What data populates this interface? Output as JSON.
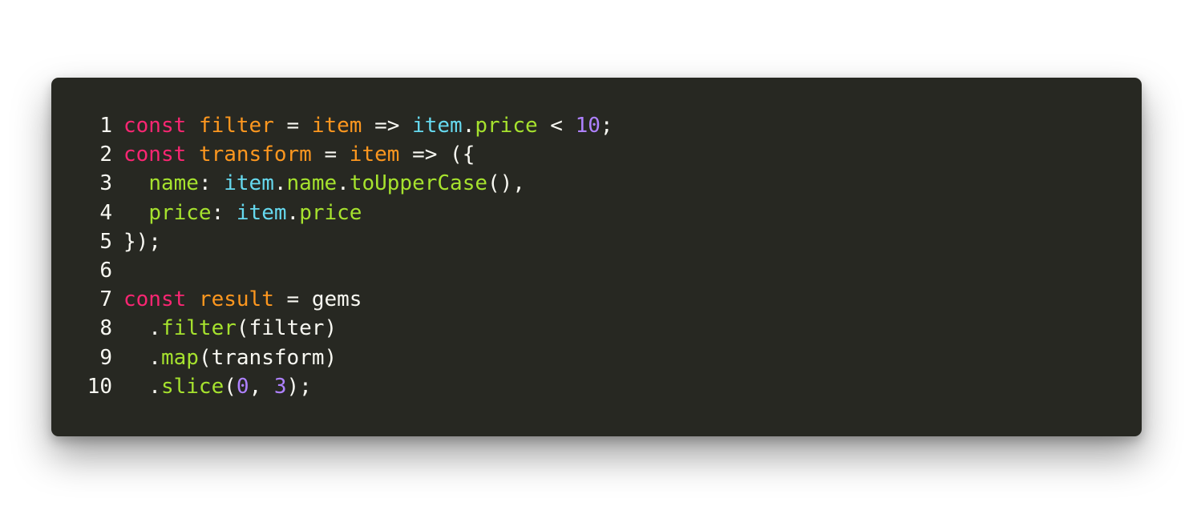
{
  "theme": {
    "background": "#272822",
    "text": "#f8f8f2",
    "keyword": "#f92672",
    "definition": "#fd971f",
    "property": "#a6e22e",
    "variable": "#66d9ef",
    "number": "#ae81ff"
  },
  "code": {
    "lines": [
      {
        "number": "1",
        "tokens": [
          {
            "text": "const",
            "type": "keyword"
          },
          {
            "text": " ",
            "type": "plain"
          },
          {
            "text": "filter",
            "type": "def"
          },
          {
            "text": " = ",
            "type": "plain"
          },
          {
            "text": "item",
            "type": "def"
          },
          {
            "text": " => ",
            "type": "plain"
          },
          {
            "text": "item",
            "type": "variable"
          },
          {
            "text": ".",
            "type": "plain"
          },
          {
            "text": "price",
            "type": "property"
          },
          {
            "text": " < ",
            "type": "plain"
          },
          {
            "text": "10",
            "type": "number"
          },
          {
            "text": ";",
            "type": "plain"
          }
        ]
      },
      {
        "number": "2",
        "tokens": [
          {
            "text": "const",
            "type": "keyword"
          },
          {
            "text": " ",
            "type": "plain"
          },
          {
            "text": "transform",
            "type": "def"
          },
          {
            "text": " = ",
            "type": "plain"
          },
          {
            "text": "item",
            "type": "def"
          },
          {
            "text": " => ({",
            "type": "plain"
          }
        ]
      },
      {
        "number": "3",
        "tokens": [
          {
            "text": "  ",
            "type": "plain"
          },
          {
            "text": "name",
            "type": "property"
          },
          {
            "text": ": ",
            "type": "plain"
          },
          {
            "text": "item",
            "type": "variable"
          },
          {
            "text": ".",
            "type": "plain"
          },
          {
            "text": "name",
            "type": "property"
          },
          {
            "text": ".",
            "type": "plain"
          },
          {
            "text": "toUpperCase",
            "type": "property"
          },
          {
            "text": "(),",
            "type": "plain"
          }
        ]
      },
      {
        "number": "4",
        "tokens": [
          {
            "text": "  ",
            "type": "plain"
          },
          {
            "text": "price",
            "type": "property"
          },
          {
            "text": ": ",
            "type": "plain"
          },
          {
            "text": "item",
            "type": "variable"
          },
          {
            "text": ".",
            "type": "plain"
          },
          {
            "text": "price",
            "type": "property"
          }
        ]
      },
      {
        "number": "5",
        "tokens": [
          {
            "text": "});",
            "type": "plain"
          }
        ]
      },
      {
        "number": "6",
        "tokens": []
      },
      {
        "number": "7",
        "tokens": [
          {
            "text": "const",
            "type": "keyword"
          },
          {
            "text": " ",
            "type": "plain"
          },
          {
            "text": "result",
            "type": "def"
          },
          {
            "text": " = gems",
            "type": "plain"
          }
        ]
      },
      {
        "number": "8",
        "tokens": [
          {
            "text": "  .",
            "type": "plain"
          },
          {
            "text": "filter",
            "type": "property"
          },
          {
            "text": "(filter)",
            "type": "plain"
          }
        ]
      },
      {
        "number": "9",
        "tokens": [
          {
            "text": "  .",
            "type": "plain"
          },
          {
            "text": "map",
            "type": "property"
          },
          {
            "text": "(transform)",
            "type": "plain"
          }
        ]
      },
      {
        "number": "10",
        "tokens": [
          {
            "text": "  .",
            "type": "plain"
          },
          {
            "text": "slice",
            "type": "property"
          },
          {
            "text": "(",
            "type": "plain"
          },
          {
            "text": "0",
            "type": "number"
          },
          {
            "text": ", ",
            "type": "plain"
          },
          {
            "text": "3",
            "type": "number"
          },
          {
            "text": ");",
            "type": "plain"
          }
        ]
      }
    ]
  }
}
